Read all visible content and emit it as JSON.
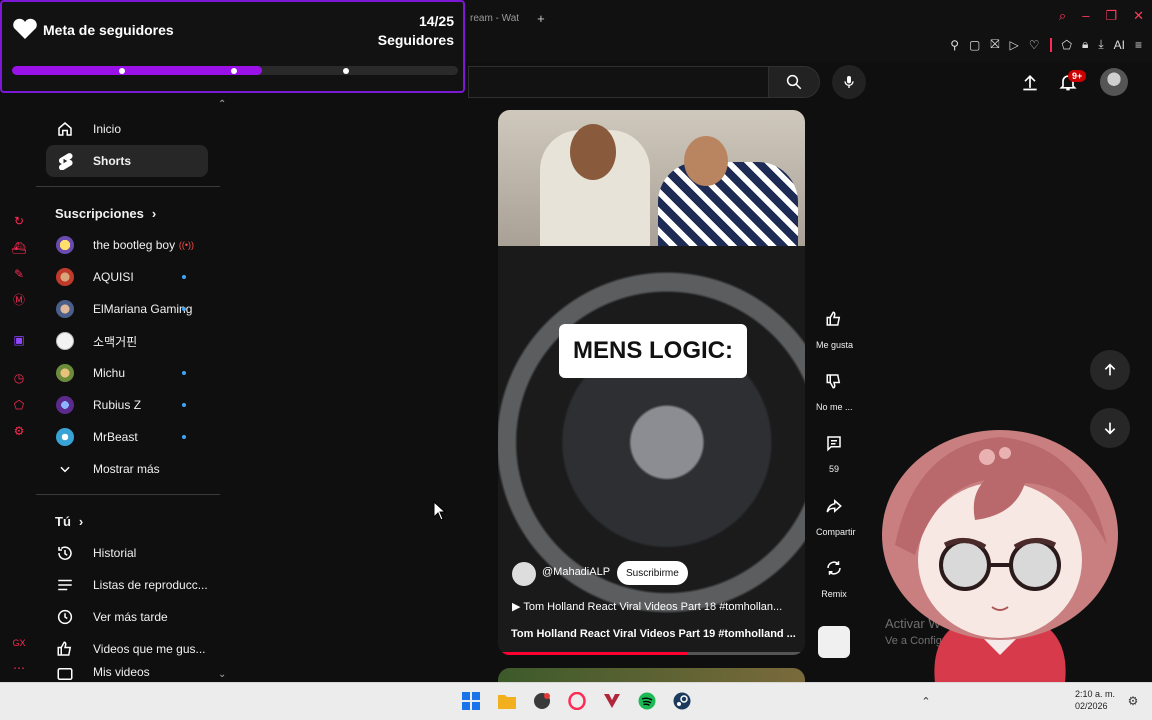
{
  "browser": {
    "tab_title": "ream - Wat",
    "new_tab_symbol": "+",
    "ext_label": "AI"
  },
  "goal": {
    "title": "Meta de seguidores",
    "count": "14/25",
    "label": "Seguidores",
    "progress": 0.56,
    "accent_color": "#9b12e8"
  },
  "topbar": {
    "notification_badge": "9+"
  },
  "sidebar": {
    "main": [
      {
        "label": "Inicio",
        "icon": "home-icon"
      },
      {
        "label": "Shorts",
        "icon": "shorts-icon",
        "active": true
      }
    ],
    "subscriptions_title": "Suscripciones",
    "subscriptions": [
      {
        "label": "the bootleg boy",
        "status": "live"
      },
      {
        "label": "AQUISI",
        "status": "new"
      },
      {
        "label": "ElMariana Gaming",
        "status": "new"
      },
      {
        "label": "소맥거핀",
        "status": ""
      },
      {
        "label": "Michu",
        "status": "new"
      },
      {
        "label": "Rubius Z",
        "status": "new"
      },
      {
        "label": "MrBeast",
        "status": "new"
      }
    ],
    "show_more": "Mostrar más",
    "you_title": "Tú",
    "you_items": [
      {
        "label": "Historial",
        "icon": "history-icon"
      },
      {
        "label": "Listas de reproducc...",
        "icon": "playlist-icon"
      },
      {
        "label": "Ver más tarde",
        "icon": "watch-later-icon"
      },
      {
        "label": "Videos que me gus...",
        "icon": "like-icon"
      },
      {
        "label": "Mis videos",
        "icon": "my-videos-icon"
      }
    ]
  },
  "short": {
    "overlay_text": "MENS LOGIC:",
    "channel": "@MahadiALP",
    "subscribe": "Suscribirme",
    "related_title": "Tom Holland React Viral Videos Part 18 #tomhollan...",
    "title": "Tom Holland React Viral Videos Part 19 #tomholland ...",
    "progress": 0.62
  },
  "actions": {
    "like": "Me gusta",
    "dislike": "No me ...",
    "comments": "59",
    "share": "Compartir",
    "remix": "Remix"
  },
  "watermark": {
    "title": "Activar W",
    "subtitle": "Ve a Configura                     Windows."
  },
  "taskbar": {
    "time": "2:10 a. m.",
    "date": "02/2026"
  }
}
